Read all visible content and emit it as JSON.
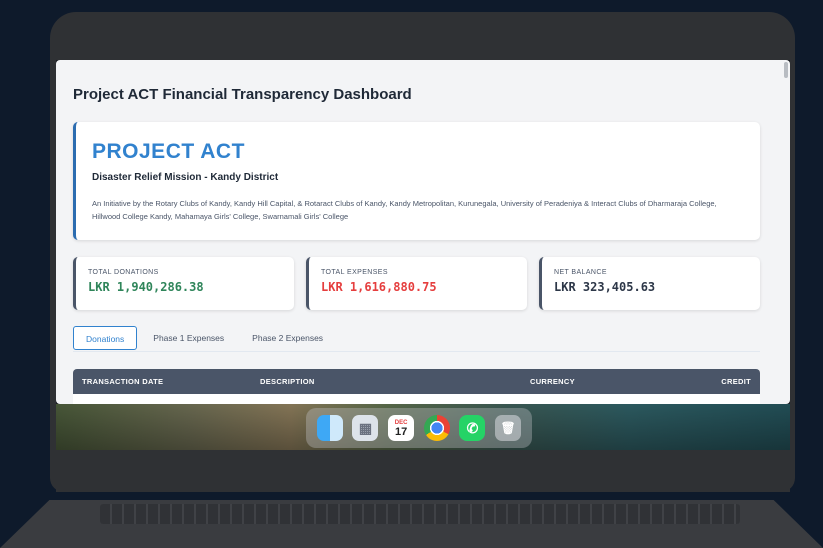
{
  "window": {
    "page_title": "Project ACT Financial Transparency Dashboard"
  },
  "hero": {
    "title": "PROJECT ACT",
    "subtitle": "Disaster Relief Mission - Kandy District",
    "description": "An Initiative by the Rotary Clubs of Kandy, Kandy Hill Capital, & Rotaract Clubs of Kandy, Kandy Metropolitan, Kurunegala, University of Peradeniya & Interact Clubs of Dharmaraja College, Hillwood College Kandy, Mahamaya Girls' College, Swarnamali Girls' College"
  },
  "stats": [
    {
      "label": "TOTAL DONATIONS",
      "value": "LKR 1,940,286.38",
      "color": "#2f855a"
    },
    {
      "label": "TOTAL EXPENSES",
      "value": "LKR 1,616,880.75",
      "color": "#e53e3e"
    },
    {
      "label": "NET BALANCE",
      "value": "LKR 323,405.63",
      "color": "#2d3748"
    }
  ],
  "tabs": [
    {
      "label": "Donations",
      "active": true
    },
    {
      "label": "Phase 1 Expenses",
      "active": false
    },
    {
      "label": "Phase 2 Expenses",
      "active": false
    }
  ],
  "table": {
    "columns": [
      "TRANSACTION DATE",
      "DESCRIPTION",
      "CURRENCY",
      "CREDIT"
    ]
  },
  "dock": {
    "calendar_month": "DEC",
    "calendar_day": "17",
    "icons": [
      "finder-icon",
      "launchpad-icon",
      "calendar-icon",
      "chrome-icon",
      "whatsapp-icon",
      "trash-icon"
    ]
  }
}
